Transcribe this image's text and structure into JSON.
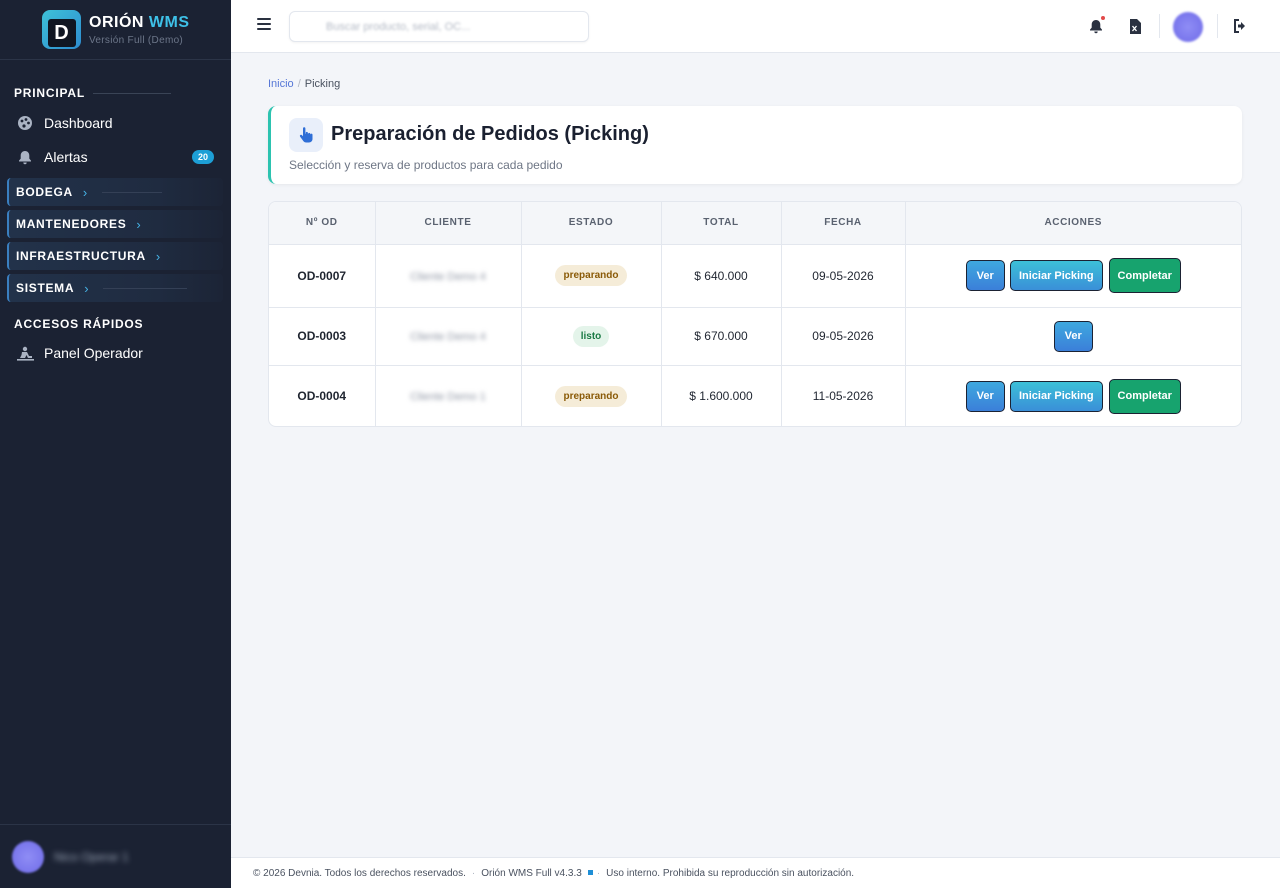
{
  "brand": {
    "logo_letter": "D",
    "name": "ORIÓN",
    "name_accent": "WMS",
    "subtitle": "Versión Full (Demo)"
  },
  "sidebar": {
    "section_principal": "PRINCIPAL",
    "items": [
      {
        "label": "Dashboard",
        "icon": "palette-icon"
      },
      {
        "label": "Alertas",
        "icon": "bell-icon",
        "badge": "20"
      }
    ],
    "groups": [
      {
        "label": "BODEGA"
      },
      {
        "label": "MANTENEDORES"
      },
      {
        "label": "INFRAESTRUCTURA"
      },
      {
        "label": "SISTEMA"
      }
    ],
    "section_quick": "ACCESOS RÁPIDOS",
    "quick_items": [
      {
        "label": "Panel Operador",
        "icon": "operator-icon"
      }
    ],
    "user_name": "Nico Operar 1"
  },
  "topbar": {
    "search_placeholder": "Buscar producto, serial, OC..."
  },
  "breadcrumb": {
    "home": "Inicio",
    "current": "Picking"
  },
  "page": {
    "title": "Preparación de Pedidos (Picking)",
    "subtitle": "Selección y reserva de productos para cada pedido"
  },
  "table": {
    "headers": [
      "Nº OD",
      "CLIENTE",
      "ESTADO",
      "TOTAL",
      "FECHA",
      "ACCIONES"
    ],
    "rows": [
      {
        "od": "OD-0007",
        "cliente": "Cliente Demo 4",
        "estado": "preparando",
        "total": "$ 640.000",
        "fecha": "09-05-2026",
        "actions": [
          "Ver",
          "Iniciar Picking",
          "Completar"
        ]
      },
      {
        "od": "OD-0003",
        "cliente": "Cliente Demo 4",
        "estado": "listo",
        "total": "$ 670.000",
        "fecha": "09-05-2026",
        "actions": [
          "Ver"
        ]
      },
      {
        "od": "OD-0004",
        "cliente": "Cliente Demo 1",
        "estado": "preparando",
        "total": "$ 1.600.000",
        "fecha": "11-05-2026",
        "actions": [
          "Ver",
          "Iniciar Picking",
          "Completar"
        ]
      }
    ]
  },
  "footer": {
    "copyright": "© 2026 Devnia. Todos los derechos reservados.",
    "version": "Orión WMS Full v4.3.3",
    "notice": "Uso interno. Prohibida su reproducción sin autorización."
  },
  "colors": {
    "sidebar_bg": "#1b2233",
    "accent": "#3ec1e8",
    "ver": "#3b7fd9",
    "completar": "#17a36e",
    "card_accent": "#2cc3b0"
  }
}
